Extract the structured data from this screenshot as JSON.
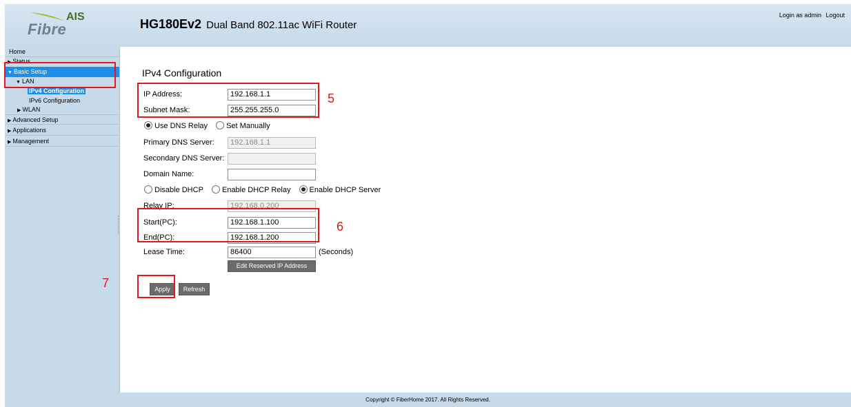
{
  "header": {
    "logo_top": "AIS",
    "logo_bottom": "Fibre",
    "model": "HG180Ev2",
    "description": "Dual Band 802.11ac WiFi Router",
    "login_text": "Login as admin",
    "logout": "Logout"
  },
  "sidebar": {
    "home": "Home",
    "status": "Status",
    "basic_setup": "Basic Setup",
    "lan": "LAN",
    "ipv4": "IPv4 Configuration",
    "ipv6": "IPv6 Configuration",
    "wlan": "WLAN",
    "advanced": "Advanced Setup",
    "applications": "Applications",
    "management": "Management"
  },
  "form": {
    "title": "IPv4 Configuration",
    "ip_label": "IP Address:",
    "ip_value": "192.168.1.1",
    "mask_label": "Subnet Mask:",
    "mask_value": "255.255.255.0",
    "dns_relay": "Use DNS Relay",
    "dns_manual": "Set Manually",
    "primary_dns_label": "Primary DNS Server:",
    "primary_dns_value": "192.168.1.1",
    "secondary_dns_label": "Secondary DNS Server:",
    "secondary_dns_value": "",
    "domain_label": "Domain Name:",
    "domain_value": "",
    "disable_dhcp": "Disable DHCP",
    "enable_relay": "Enable DHCP Relay",
    "enable_server": "Enable DHCP Server",
    "relay_ip_label": "Relay IP:",
    "relay_ip_value": "192.168.0.200",
    "start_label": "Start(PC):",
    "start_value": "192.168.1.100",
    "end_label": "End(PC):",
    "end_value": "192.168.1.200",
    "lease_label": "Lease Time:",
    "lease_value": "86400",
    "seconds": "(Seconds)",
    "edit_reserved": "Edit Reserved IP Address",
    "apply": "Apply",
    "refresh": "Refresh"
  },
  "annotations": {
    "n5": "5",
    "n6": "6",
    "n7": "7"
  },
  "footer": "Copyright © FiberHome 2017. All Rights Reserved.",
  "colors": {
    "accent": "#1e8fe9",
    "annotation": "#e4161b",
    "panel": "#c7daea"
  }
}
